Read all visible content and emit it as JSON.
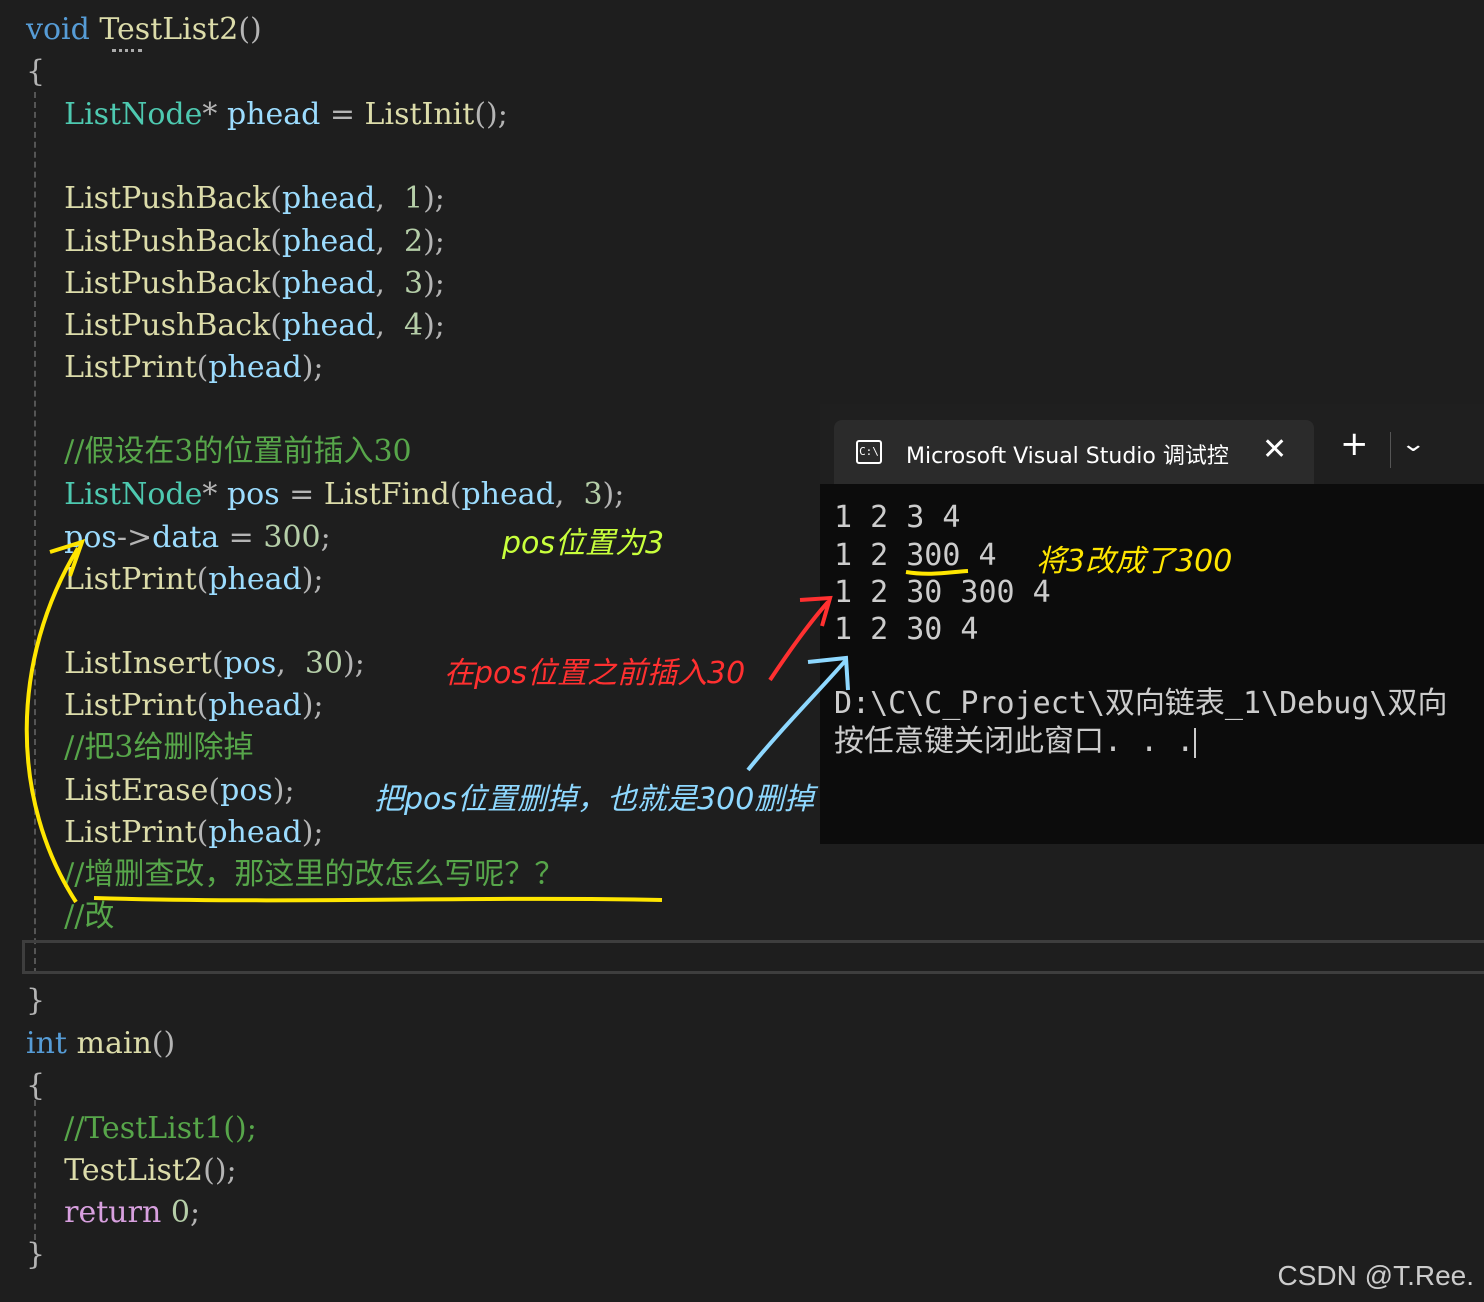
{
  "editor": {
    "lines": [
      [
        {
          "t": "void",
          "c": "kw"
        },
        {
          "t": " "
        },
        {
          "t": "TestList2",
          "c": "fn"
        },
        {
          "t": "()",
          "c": "pn"
        }
      ],
      [
        {
          "t": "{",
          "c": "pn"
        }
      ],
      [
        {
          "t": "    "
        },
        {
          "t": "ListNode",
          "c": "ty"
        },
        {
          "t": "* ",
          "c": "pn"
        },
        {
          "t": "phead",
          "c": "va"
        },
        {
          "t": " = ",
          "c": "pn"
        },
        {
          "t": "ListInit",
          "c": "fn"
        },
        {
          "t": "();",
          "c": "pn"
        }
      ],
      [
        {
          "t": "    "
        },
        {
          "t": "ListPushBack",
          "c": "fn"
        },
        {
          "t": "(",
          "c": "pn"
        },
        {
          "t": "phead",
          "c": "va"
        },
        {
          "t": ",  ",
          "c": "pn"
        },
        {
          "t": "1",
          "c": "nu"
        },
        {
          "t": ");",
          "c": "pn"
        }
      ],
      [
        {
          "t": "    "
        },
        {
          "t": "ListPushBack",
          "c": "fn"
        },
        {
          "t": "(",
          "c": "pn"
        },
        {
          "t": "phead",
          "c": "va"
        },
        {
          "t": ",  ",
          "c": "pn"
        },
        {
          "t": "2",
          "c": "nu"
        },
        {
          "t": ");",
          "c": "pn"
        }
      ],
      [
        {
          "t": "    "
        },
        {
          "t": "ListPushBack",
          "c": "fn"
        },
        {
          "t": "(",
          "c": "pn"
        },
        {
          "t": "phead",
          "c": "va"
        },
        {
          "t": ",  ",
          "c": "pn"
        },
        {
          "t": "3",
          "c": "nu"
        },
        {
          "t": ");",
          "c": "pn"
        }
      ],
      [
        {
          "t": "    "
        },
        {
          "t": "ListPushBack",
          "c": "fn"
        },
        {
          "t": "(",
          "c": "pn"
        },
        {
          "t": "phead",
          "c": "va"
        },
        {
          "t": ",  ",
          "c": "pn"
        },
        {
          "t": "4",
          "c": "nu"
        },
        {
          "t": ");",
          "c": "pn"
        }
      ],
      [
        {
          "t": "    "
        },
        {
          "t": "ListPrint",
          "c": "fn"
        },
        {
          "t": "(",
          "c": "pn"
        },
        {
          "t": "phead",
          "c": "va"
        },
        {
          "t": ");",
          "c": "pn"
        }
      ],
      [
        {
          "t": "    "
        },
        {
          "t": "//假设在3的位置前插入30",
          "c": "co"
        }
      ],
      [
        {
          "t": "    "
        },
        {
          "t": "ListNode",
          "c": "ty"
        },
        {
          "t": "* ",
          "c": "pn"
        },
        {
          "t": "pos",
          "c": "va"
        },
        {
          "t": " = ",
          "c": "pn"
        },
        {
          "t": "ListFind",
          "c": "fn"
        },
        {
          "t": "(",
          "c": "pn"
        },
        {
          "t": "phead",
          "c": "va"
        },
        {
          "t": ",  ",
          "c": "pn"
        },
        {
          "t": "3",
          "c": "nu"
        },
        {
          "t": ");",
          "c": "pn"
        }
      ],
      [
        {
          "t": "    "
        },
        {
          "t": "pos",
          "c": "va"
        },
        {
          "t": "->",
          "c": "pn"
        },
        {
          "t": "data",
          "c": "va"
        },
        {
          "t": " = ",
          "c": "pn"
        },
        {
          "t": "300",
          "c": "nu"
        },
        {
          "t": ";",
          "c": "pn"
        }
      ],
      [
        {
          "t": "    "
        },
        {
          "t": "ListPrint",
          "c": "fn"
        },
        {
          "t": "(",
          "c": "pn"
        },
        {
          "t": "phead",
          "c": "va"
        },
        {
          "t": ");",
          "c": "pn"
        }
      ],
      [
        {
          "t": "    "
        },
        {
          "t": "ListInsert",
          "c": "fn"
        },
        {
          "t": "(",
          "c": "pn"
        },
        {
          "t": "pos",
          "c": "va"
        },
        {
          "t": ",  ",
          "c": "pn"
        },
        {
          "t": "30",
          "c": "nu"
        },
        {
          "t": ");",
          "c": "pn"
        }
      ],
      [
        {
          "t": "    "
        },
        {
          "t": "ListPrint",
          "c": "fn"
        },
        {
          "t": "(",
          "c": "pn"
        },
        {
          "t": "phead",
          "c": "va"
        },
        {
          "t": ");",
          "c": "pn"
        }
      ],
      [
        {
          "t": "    "
        },
        {
          "t": "//把3给删除掉",
          "c": "co"
        }
      ],
      [
        {
          "t": "    "
        },
        {
          "t": "ListErase",
          "c": "fn"
        },
        {
          "t": "(",
          "c": "pn"
        },
        {
          "t": "pos",
          "c": "va"
        },
        {
          "t": ");",
          "c": "pn"
        }
      ],
      [
        {
          "t": "    "
        },
        {
          "t": "ListPrint",
          "c": "fn"
        },
        {
          "t": "(",
          "c": "pn"
        },
        {
          "t": "phead",
          "c": "va"
        },
        {
          "t": ");",
          "c": "pn"
        }
      ],
      [
        {
          "t": "    "
        },
        {
          "t": "//增删查改，那这里的改怎么写呢？？",
          "c": "co"
        }
      ],
      [
        {
          "t": "    "
        },
        {
          "t": "//改",
          "c": "co"
        }
      ],
      [
        {
          "t": "}",
          "c": "pn"
        }
      ],
      [
        {
          "t": "int",
          "c": "kw"
        },
        {
          "t": " "
        },
        {
          "t": "main",
          "c": "fn"
        },
        {
          "t": "()",
          "c": "pn"
        }
      ],
      [
        {
          "t": "{",
          "c": "pn"
        }
      ],
      [
        {
          "t": "    "
        },
        {
          "t": "//TestList1();",
          "c": "co"
        }
      ],
      [
        {
          "t": "    "
        },
        {
          "t": "TestList2",
          "c": "fn"
        },
        {
          "t": "();",
          "c": "pn"
        }
      ],
      [
        {
          "t": "    "
        },
        {
          "t": "return",
          "c": "kw2"
        },
        {
          "t": " "
        },
        {
          "t": "0",
          "c": "nu"
        },
        {
          "t": ";",
          "c": "pn"
        }
      ],
      [
        {
          "t": "}",
          "c": "pn"
        }
      ]
    ]
  },
  "annotations": {
    "pos_set": "pos位置为3",
    "insert_before": "在pos位置之前插入30",
    "erase": "把pos位置删掉，也就是300删掉",
    "changed": "将3改成了300"
  },
  "console": {
    "tab_title": "Microsoft Visual Studio 调试控",
    "tab_icon_text": "C:\\",
    "close_glyph": "✕",
    "new_tab_glyph": "+",
    "dropdown_glyph": "⌄",
    "output": [
      "1 2 3 4",
      "1 2 300 4",
      "1 2 30 300 4",
      "1 2 30 4",
      "",
      "D:\\C\\C_Project\\双向链表_1\\Debug\\双向",
      "按任意键关闭此窗口. . ."
    ]
  },
  "watermark": "CSDN @T.Ree.",
  "colors": {
    "background": "#1e1e1e",
    "keyword": "#569cd6",
    "function": "#dcdcaa",
    "type": "#4ec9b0",
    "variable": "#9cdcfe",
    "number": "#b5cea8",
    "comment": "#57a64a",
    "annotation_yellow": "#ffe600",
    "annotation_red": "#ff3030",
    "annotation_blue": "#8ed8ff",
    "annotation_green": "#c8ff3c"
  }
}
